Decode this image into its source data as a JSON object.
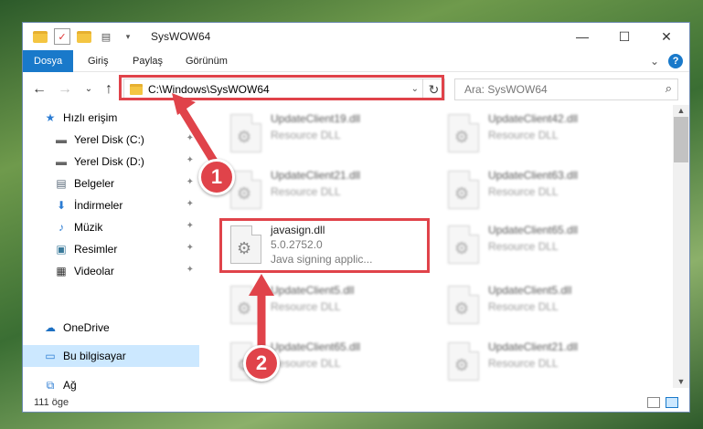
{
  "window": {
    "title": "SysWOW64",
    "controls": {
      "minimize": "—",
      "maximize": "☐",
      "close": "✕"
    }
  },
  "ribbon": {
    "tabs": [
      {
        "label": "Dosya",
        "active": true
      },
      {
        "label": "Giriş",
        "active": false
      },
      {
        "label": "Paylaş",
        "active": false
      },
      {
        "label": "Görünüm",
        "active": false
      }
    ],
    "expand": "⌄",
    "help": "?"
  },
  "nav": {
    "back": "←",
    "forward": "→",
    "recent": "⌄",
    "up": "↑",
    "address": "C:\\Windows\\SysWOW64",
    "address_drop": "⌄",
    "refresh": "↻",
    "search_placeholder": "Ara: SysWOW64",
    "search_icon": "⌕"
  },
  "sidebar": {
    "items": [
      {
        "label": "Hızlı erişim",
        "icon": "star-icon",
        "glyph": "★",
        "pinned": false
      },
      {
        "label": "Yerel Disk (C:)",
        "icon": "drive-icon",
        "glyph": "▬",
        "pinned": true
      },
      {
        "label": "Yerel Disk (D:)",
        "icon": "drive-icon",
        "glyph": "▬",
        "pinned": true
      },
      {
        "label": "Belgeler",
        "icon": "documents-icon",
        "glyph": "▤",
        "pinned": true
      },
      {
        "label": "İndirmeler",
        "icon": "download-icon",
        "glyph": "⬇",
        "pinned": true
      },
      {
        "label": "Müzik",
        "icon": "music-icon",
        "glyph": "♪",
        "pinned": true
      },
      {
        "label": "Resimler",
        "icon": "pictures-icon",
        "glyph": "▣",
        "pinned": true
      },
      {
        "label": "Videolar",
        "icon": "video-icon",
        "glyph": "▦",
        "pinned": true
      },
      {
        "label": "OneDrive",
        "icon": "cloud-icon",
        "glyph": "☁",
        "pinned": false
      },
      {
        "label": "Bu bilgisayar",
        "icon": "computer-icon",
        "glyph": "▭",
        "pinned": false,
        "selected": true
      },
      {
        "label": "Ağ",
        "icon": "network-icon",
        "glyph": "⧉",
        "pinned": false
      }
    ],
    "pin_glyph": "✦"
  },
  "files": {
    "highlighted": {
      "name": "javasign.dll",
      "version": "5.0.2752.0",
      "description": "Java signing applic..."
    },
    "others": [
      {
        "name": "UpdateClient19.dll",
        "desc": "Resource DLL"
      },
      {
        "name": "UpdateClient42.dll",
        "desc": "Resource DLL"
      },
      {
        "name": "UpdateClient21.dll",
        "desc": "Resource DLL"
      },
      {
        "name": "UpdateClient63.dll",
        "desc": "Resource DLL"
      },
      {
        "name": "UpdateClient65.dll",
        "desc": "Resource DLL"
      },
      {
        "name": "UpdateClient5.dll",
        "desc": "Resource DLL"
      },
      {
        "name": "UpdateClient5.dll",
        "desc": "Resource DLL"
      },
      {
        "name": "UpdateClient65.dll",
        "desc": "Resource DLL"
      },
      {
        "name": "UpdateClient21.dll",
        "desc": "Resource DLL"
      }
    ],
    "gear_glyph": "⚙"
  },
  "status": {
    "count": "111 öge"
  },
  "annotations": {
    "marker1": "1",
    "marker2": "2",
    "color": "#e0434a"
  }
}
